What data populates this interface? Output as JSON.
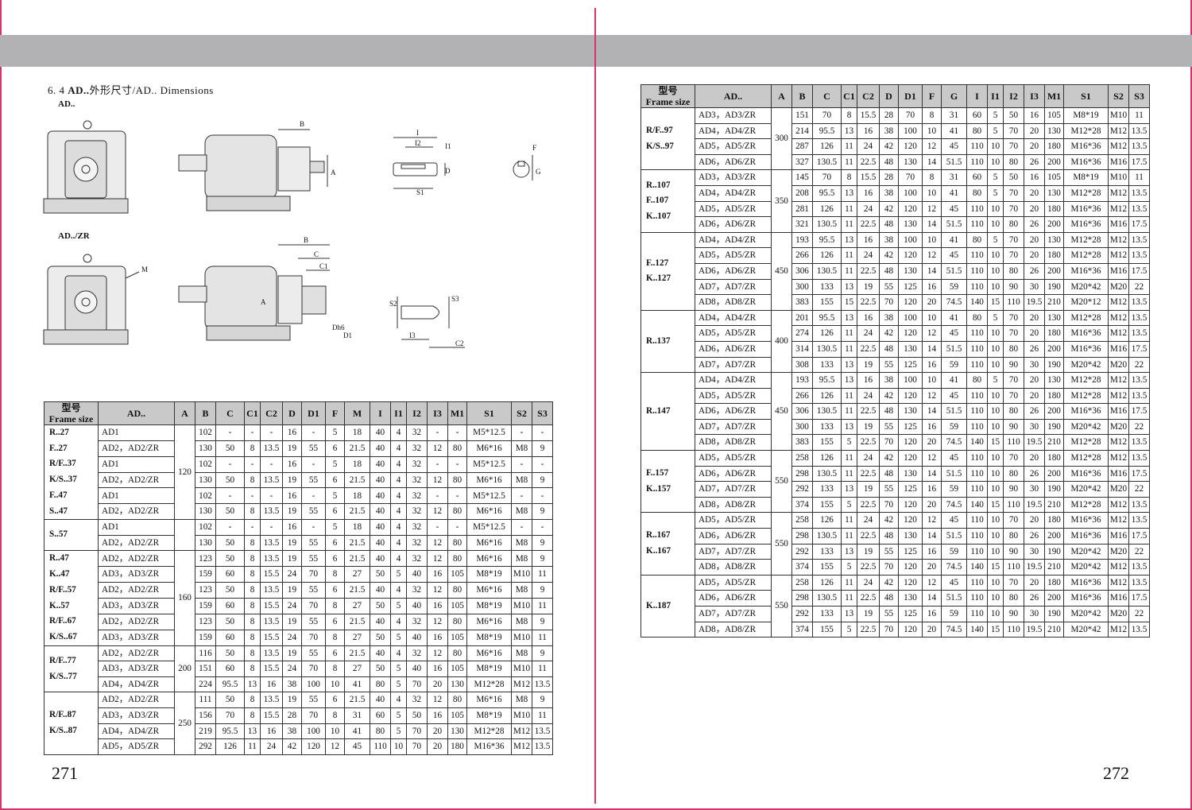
{
  "pages": {
    "left_number": "271",
    "right_number": "272"
  },
  "section_heading": {
    "prefix": "6. 4 ",
    "bold": "AD..",
    "rest": "外形尺寸/AD.. Dimensions"
  },
  "drawing_labels": {
    "ad": "AD..",
    "adzr": "AD../ZR"
  },
  "diagram_labels": [
    "B",
    "A",
    "I",
    "I2",
    "I1",
    "D",
    "S1",
    "F",
    "G",
    "M",
    "C",
    "C1",
    "S2",
    "S3",
    "I3",
    "C2",
    "Dh6",
    "D1"
  ],
  "table_header": {
    "frame_cn": "型号",
    "frame_en": "Frame size",
    "cols": [
      "AD..",
      "A",
      "B",
      "C",
      "C1",
      "C2",
      "D",
      "D1",
      "F",
      "M",
      "I",
      "I1",
      "I2",
      "I3",
      "M1",
      "S1",
      "S2",
      "S3"
    ]
  },
  "table_header_right": {
    "cols": [
      "AD..",
      "A",
      "B",
      "C",
      "C1",
      "C2",
      "D",
      "D1",
      "F",
      "G",
      "I",
      "I1",
      "I2",
      "I3",
      "M1",
      "S1",
      "S2",
      "S3"
    ]
  },
  "left_groups": [
    {
      "frames": "R..27\nF..27\nR/F..37\nK/S..37\nF..47\nS..47",
      "a": "120",
      "rows": [
        [
          "AD1",
          "102",
          "-",
          "-",
          "-",
          "16",
          "-",
          "5",
          "18",
          "40",
          "4",
          "32",
          "-",
          "-",
          "M5*12.5",
          "-",
          "-"
        ],
        [
          "AD2，AD2/ZR",
          "130",
          "50",
          "8",
          "13.5",
          "19",
          "55",
          "6",
          "21.5",
          "40",
          "4",
          "32",
          "12",
          "80",
          "M6*16",
          "M8",
          "9"
        ],
        [
          "AD1",
          "102",
          "-",
          "-",
          "-",
          "16",
          "-",
          "5",
          "18",
          "40",
          "4",
          "32",
          "-",
          "-",
          "M5*12.5",
          "-",
          "-"
        ],
        [
          "AD2，AD2/ZR",
          "130",
          "50",
          "8",
          "13.5",
          "19",
          "55",
          "6",
          "21.5",
          "40",
          "4",
          "32",
          "12",
          "80",
          "M6*16",
          "M8",
          "9"
        ],
        [
          "AD1",
          "102",
          "-",
          "-",
          "-",
          "16",
          "-",
          "5",
          "18",
          "40",
          "4",
          "32",
          "-",
          "-",
          "M5*12.5",
          "-",
          "-"
        ],
        [
          "AD2，AD2/ZR",
          "130",
          "50",
          "8",
          "13.5",
          "19",
          "55",
          "6",
          "21.5",
          "40",
          "4",
          "32",
          "12",
          "80",
          "M6*16",
          "M8",
          "9"
        ]
      ]
    },
    {
      "frames": "S..57",
      "a": "",
      "rows": [
        [
          "AD1",
          "102",
          "-",
          "-",
          "-",
          "16",
          "-",
          "5",
          "18",
          "40",
          "4",
          "32",
          "-",
          "-",
          "M5*12.5",
          "-",
          "-"
        ],
        [
          "AD2，AD2/ZR",
          "130",
          "50",
          "8",
          "13.5",
          "19",
          "55",
          "6",
          "21.5",
          "40",
          "4",
          "32",
          "12",
          "80",
          "M6*16",
          "M8",
          "9"
        ]
      ]
    },
    {
      "frames": "R..47\nK..47\nR/F..57\nK..57\nR/F..67\nK/S..67",
      "a": "160",
      "rows": [
        [
          "AD2，AD2/ZR",
          "123",
          "50",
          "8",
          "13.5",
          "19",
          "55",
          "6",
          "21.5",
          "40",
          "4",
          "32",
          "12",
          "80",
          "M6*16",
          "M8",
          "9"
        ],
        [
          "AD3，AD3/ZR",
          "159",
          "60",
          "8",
          "15.5",
          "24",
          "70",
          "8",
          "27",
          "50",
          "5",
          "40",
          "16",
          "105",
          "M8*19",
          "M10",
          "11"
        ],
        [
          "AD2，AD2/ZR",
          "123",
          "50",
          "8",
          "13.5",
          "19",
          "55",
          "6",
          "21.5",
          "40",
          "4",
          "32",
          "12",
          "80",
          "M6*16",
          "M8",
          "9"
        ],
        [
          "AD3，AD3/ZR",
          "159",
          "60",
          "8",
          "15.5",
          "24",
          "70",
          "8",
          "27",
          "50",
          "5",
          "40",
          "16",
          "105",
          "M8*19",
          "M10",
          "11"
        ],
        [
          "AD2，AD2/ZR",
          "123",
          "50",
          "8",
          "13.5",
          "19",
          "55",
          "6",
          "21.5",
          "40",
          "4",
          "32",
          "12",
          "80",
          "M6*16",
          "M8",
          "9"
        ],
        [
          "AD3，AD3/ZR",
          "159",
          "60",
          "8",
          "15.5",
          "24",
          "70",
          "8",
          "27",
          "50",
          "5",
          "40",
          "16",
          "105",
          "M8*19",
          "M10",
          "11"
        ]
      ]
    },
    {
      "frames": "R/F..77\nK/S..77",
      "a": "200",
      "rows": [
        [
          "AD2，AD2/ZR",
          "116",
          "50",
          "8",
          "13.5",
          "19",
          "55",
          "6",
          "21.5",
          "40",
          "4",
          "32",
          "12",
          "80",
          "M6*16",
          "M8",
          "9"
        ],
        [
          "AD3，AD3/ZR",
          "151",
          "60",
          "8",
          "15.5",
          "24",
          "70",
          "8",
          "27",
          "50",
          "5",
          "40",
          "16",
          "105",
          "M8*19",
          "M10",
          "11"
        ],
        [
          "AD4，AD4/ZR",
          "224",
          "95.5",
          "13",
          "16",
          "38",
          "100",
          "10",
          "41",
          "80",
          "5",
          "70",
          "20",
          "130",
          "M12*28",
          "M12",
          "13.5"
        ]
      ]
    },
    {
      "frames": "R/F..87\nK/S..87",
      "a": "250",
      "rows": [
        [
          "AD2，AD2/ZR",
          "111",
          "50",
          "8",
          "13.5",
          "19",
          "55",
          "6",
          "21.5",
          "40",
          "4",
          "32",
          "12",
          "80",
          "M6*16",
          "M8",
          "9"
        ],
        [
          "AD3，AD3/ZR",
          "156",
          "70",
          "8",
          "15.5",
          "28",
          "70",
          "8",
          "31",
          "60",
          "5",
          "50",
          "16",
          "105",
          "M8*19",
          "M10",
          "11"
        ],
        [
          "AD4，AD4/ZR",
          "219",
          "95.5",
          "13",
          "16",
          "38",
          "100",
          "10",
          "41",
          "80",
          "5",
          "70",
          "20",
          "130",
          "M12*28",
          "M12",
          "13.5"
        ],
        [
          "AD5，AD5/ZR",
          "292",
          "126",
          "11",
          "24",
          "42",
          "120",
          "12",
          "45",
          "110",
          "10",
          "70",
          "20",
          "180",
          "M16*36",
          "M12",
          "13.5"
        ]
      ]
    }
  ],
  "right_groups": [
    {
      "frames": "R/F..97\nK/S..97",
      "a": "300",
      "rows": [
        [
          "AD3，AD3/ZR",
          "151",
          "70",
          "8",
          "15.5",
          "28",
          "70",
          "8",
          "31",
          "60",
          "5",
          "50",
          "16",
          "105",
          "M8*19",
          "M10",
          "11"
        ],
        [
          "AD4，AD4/ZR",
          "214",
          "95.5",
          "13",
          "16",
          "38",
          "100",
          "10",
          "41",
          "80",
          "5",
          "70",
          "20",
          "130",
          "M12*28",
          "M12",
          "13.5"
        ],
        [
          "AD5，AD5/ZR",
          "287",
          "126",
          "11",
          "24",
          "42",
          "120",
          "12",
          "45",
          "110",
          "10",
          "70",
          "20",
          "180",
          "M16*36",
          "M12",
          "13.5"
        ],
        [
          "AD6，AD6/ZR",
          "327",
          "130.5",
          "11",
          "22.5",
          "48",
          "130",
          "14",
          "51.5",
          "110",
          "10",
          "80",
          "26",
          "200",
          "M16*36",
          "M16",
          "17.5"
        ]
      ]
    },
    {
      "frames": "R..107\nF..107\nK..107",
      "a": "350",
      "rows": [
        [
          "AD3，AD3/ZR",
          "145",
          "70",
          "8",
          "15.5",
          "28",
          "70",
          "8",
          "31",
          "60",
          "5",
          "50",
          "16",
          "105",
          "M8*19",
          "M10",
          "11"
        ],
        [
          "AD4，AD4/ZR",
          "208",
          "95.5",
          "13",
          "16",
          "38",
          "100",
          "10",
          "41",
          "80",
          "5",
          "70",
          "20",
          "130",
          "M12*28",
          "M12",
          "13.5"
        ],
        [
          "AD5，AD5/ZR",
          "281",
          "126",
          "11",
          "24",
          "42",
          "120",
          "12",
          "45",
          "110",
          "10",
          "70",
          "20",
          "180",
          "M16*36",
          "M12",
          "13.5"
        ],
        [
          "AD6，AD6/ZR",
          "321",
          "130.5",
          "11",
          "22.5",
          "48",
          "130",
          "14",
          "51.5",
          "110",
          "10",
          "80",
          "26",
          "200",
          "M16*36",
          "M16",
          "17.5"
        ]
      ]
    },
    {
      "frames": "F..127\nK..127",
      "a": "450",
      "rows": [
        [
          "AD4，AD4/ZR",
          "193",
          "95.5",
          "13",
          "16",
          "38",
          "100",
          "10",
          "41",
          "80",
          "5",
          "70",
          "20",
          "130",
          "M12*28",
          "M12",
          "13.5"
        ],
        [
          "AD5，AD5/ZR",
          "266",
          "126",
          "11",
          "24",
          "42",
          "120",
          "12",
          "45",
          "110",
          "10",
          "70",
          "20",
          "180",
          "M12*28",
          "M12",
          "13.5"
        ],
        [
          "AD6，AD6/ZR",
          "306",
          "130.5",
          "11",
          "22.5",
          "48",
          "130",
          "14",
          "51.5",
          "110",
          "10",
          "80",
          "26",
          "200",
          "M16*36",
          "M16",
          "17.5"
        ],
        [
          "AD7，AD7/ZR",
          "300",
          "133",
          "13",
          "19",
          "55",
          "125",
          "16",
          "59",
          "110",
          "10",
          "90",
          "30",
          "190",
          "M20*42",
          "M20",
          "22"
        ],
        [
          "AD8，AD8/ZR",
          "383",
          "155",
          "15",
          "22.5",
          "70",
          "120",
          "20",
          "74.5",
          "140",
          "15",
          "110",
          "19.5",
          "210",
          "M20*12",
          "M12",
          "13.5"
        ]
      ]
    },
    {
      "frames": "R..137",
      "a": "400",
      "rows": [
        [
          "AD4，AD4/ZR",
          "201",
          "95.5",
          "13",
          "16",
          "38",
          "100",
          "10",
          "41",
          "80",
          "5",
          "70",
          "20",
          "130",
          "M12*28",
          "M12",
          "13.5"
        ],
        [
          "AD5，AD5/ZR",
          "274",
          "126",
          "11",
          "24",
          "42",
          "120",
          "12",
          "45",
          "110",
          "10",
          "70",
          "20",
          "180",
          "M16*36",
          "M12",
          "13.5"
        ],
        [
          "AD6，AD6/ZR",
          "314",
          "130.5",
          "11",
          "22.5",
          "48",
          "130",
          "14",
          "51.5",
          "110",
          "10",
          "80",
          "26",
          "200",
          "M16*36",
          "M16",
          "17.5"
        ],
        [
          "AD7，AD7/ZR",
          "308",
          "133",
          "13",
          "19",
          "55",
          "125",
          "16",
          "59",
          "110",
          "10",
          "90",
          "30",
          "190",
          "M20*42",
          "M20",
          "22"
        ]
      ]
    },
    {
      "frames": "R..147",
      "a": "450",
      "rows": [
        [
          "AD4，AD4/ZR",
          "193",
          "95.5",
          "13",
          "16",
          "38",
          "100",
          "10",
          "41",
          "80",
          "5",
          "70",
          "20",
          "130",
          "M12*28",
          "M12",
          "13.5"
        ],
        [
          "AD5，AD5/ZR",
          "266",
          "126",
          "11",
          "24",
          "42",
          "120",
          "12",
          "45",
          "110",
          "10",
          "70",
          "20",
          "180",
          "M12*28",
          "M12",
          "13.5"
        ],
        [
          "AD6，AD6/ZR",
          "306",
          "130.5",
          "11",
          "22.5",
          "48",
          "130",
          "14",
          "51.5",
          "110",
          "10",
          "80",
          "26",
          "200",
          "M16*36",
          "M16",
          "17.5"
        ],
        [
          "AD7，AD7/ZR",
          "300",
          "133",
          "13",
          "19",
          "55",
          "125",
          "16",
          "59",
          "110",
          "10",
          "90",
          "30",
          "190",
          "M20*42",
          "M20",
          "22"
        ],
        [
          "AD8，AD8/ZR",
          "383",
          "155",
          "5",
          "22.5",
          "70",
          "120",
          "20",
          "74.5",
          "140",
          "15",
          "110",
          "19.5",
          "210",
          "M12*28",
          "M12",
          "13.5"
        ]
      ]
    },
    {
      "frames": "F..157\nK..157",
      "a": "550",
      "rows": [
        [
          "AD5，AD5/ZR",
          "258",
          "126",
          "11",
          "24",
          "42",
          "120",
          "12",
          "45",
          "110",
          "10",
          "70",
          "20",
          "180",
          "M12*28",
          "M12",
          "13.5"
        ],
        [
          "AD6，AD6/ZR",
          "298",
          "130.5",
          "11",
          "22.5",
          "48",
          "130",
          "14",
          "51.5",
          "110",
          "10",
          "80",
          "26",
          "200",
          "M16*36",
          "M16",
          "17.5"
        ],
        [
          "AD7，AD7/ZR",
          "292",
          "133",
          "13",
          "19",
          "55",
          "125",
          "16",
          "59",
          "110",
          "10",
          "90",
          "30",
          "190",
          "M20*42",
          "M20",
          "22"
        ],
        [
          "AD8，AD8/ZR",
          "374",
          "155",
          "5",
          "22.5",
          "70",
          "120",
          "20",
          "74.5",
          "140",
          "15",
          "110",
          "19.5",
          "210",
          "M12*28",
          "M12",
          "13.5"
        ]
      ]
    },
    {
      "frames": "R..167\nK..167",
      "a": "550",
      "rows": [
        [
          "AD5，AD5/ZR",
          "258",
          "126",
          "11",
          "24",
          "42",
          "120",
          "12",
          "45",
          "110",
          "10",
          "70",
          "20",
          "180",
          "M16*36",
          "M12",
          "13.5"
        ],
        [
          "AD6，AD6/ZR",
          "298",
          "130.5",
          "11",
          "22.5",
          "48",
          "130",
          "14",
          "51.5",
          "110",
          "10",
          "80",
          "26",
          "200",
          "M16*36",
          "M16",
          "17.5"
        ],
        [
          "AD7，AD7/ZR",
          "292",
          "133",
          "13",
          "19",
          "55",
          "125",
          "16",
          "59",
          "110",
          "10",
          "90",
          "30",
          "190",
          "M20*42",
          "M20",
          "22"
        ],
        [
          "AD8，AD8/ZR",
          "374",
          "155",
          "5",
          "22.5",
          "70",
          "120",
          "20",
          "74.5",
          "140",
          "15",
          "110",
          "19.5",
          "210",
          "M20*42",
          "M12",
          "13.5"
        ]
      ]
    },
    {
      "frames": "K..187",
      "a": "550",
      "rows": [
        [
          "AD5，AD5/ZR",
          "258",
          "126",
          "11",
          "24",
          "42",
          "120",
          "12",
          "45",
          "110",
          "10",
          "70",
          "20",
          "180",
          "M16*36",
          "M12",
          "13.5"
        ],
        [
          "AD6，AD6/ZR",
          "298",
          "130.5",
          "11",
          "22.5",
          "48",
          "130",
          "14",
          "51.5",
          "110",
          "10",
          "80",
          "26",
          "200",
          "M16*36",
          "M16",
          "17.5"
        ],
        [
          "AD7，AD7/ZR",
          "292",
          "133",
          "13",
          "19",
          "55",
          "125",
          "16",
          "59",
          "110",
          "10",
          "90",
          "30",
          "190",
          "M20*42",
          "M20",
          "22"
        ],
        [
          "AD8，AD8/ZR",
          "374",
          "155",
          "5",
          "22.5",
          "70",
          "120",
          "20",
          "74.5",
          "140",
          "15",
          "110",
          "19.5",
          "210",
          "M20*42",
          "M12",
          "13.5"
        ]
      ]
    }
  ]
}
